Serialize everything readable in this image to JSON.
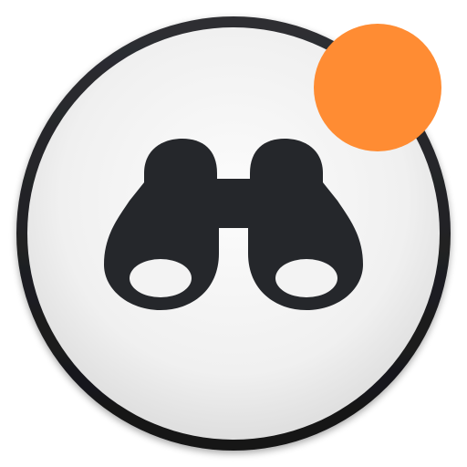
{
  "icon": {
    "name": "binoculars-icon",
    "badge": "notification-dot"
  },
  "colors": {
    "ring_outer": "#1f2023",
    "ring_inner": "#2a2b2f",
    "face_light": "#fbfbfb",
    "face_dark": "#e3e3e3",
    "glyph": "#25272b",
    "badge": "#ff8c33"
  }
}
